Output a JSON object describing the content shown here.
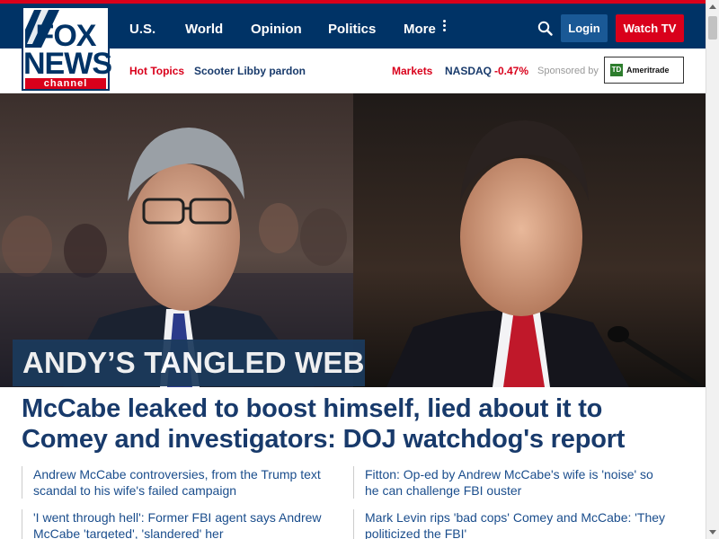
{
  "brand": {
    "logo_line1": "FOX",
    "logo_line2": "NEWS",
    "logo_channel": "channel"
  },
  "nav": {
    "links": [
      "U.S.",
      "World",
      "Opinion",
      "Politics",
      "More"
    ],
    "login_label": "Login",
    "watch_label": "Watch TV"
  },
  "subnav": {
    "hot_topics_label": "Hot Topics",
    "hot_topic_item": "Scooter Libby pardon",
    "markets_label": "Markets",
    "index_name": "NASDAQ",
    "index_change": "-0.47%",
    "sponsored_label": "Sponsored by",
    "sponsor_name": "Ameritrade",
    "sponsor_mark": "TD"
  },
  "hero": {
    "banner": "ANDY’S TANGLED WEB",
    "headline": "McCabe leaked to boost himself, lied about it to Comey and investigators: DOJ watchdog's report"
  },
  "related": [
    "Andrew McCabe controversies, from the Trump text scandal to his wife's failed campaign",
    "Fitton: Op-ed by Andrew McCabe's wife is 'noise' so he can challenge FBI ouster",
    "'I went through hell': Former FBI agent says Andrew McCabe 'targeted', 'slandered' her",
    "Mark Levin rips 'bad cops' Comey and McCabe: 'They politicized the FBI'"
  ],
  "colors": {
    "navy": "#003366",
    "red": "#d9001b",
    "headline": "#183a6b",
    "link": "#1a4d8c"
  }
}
